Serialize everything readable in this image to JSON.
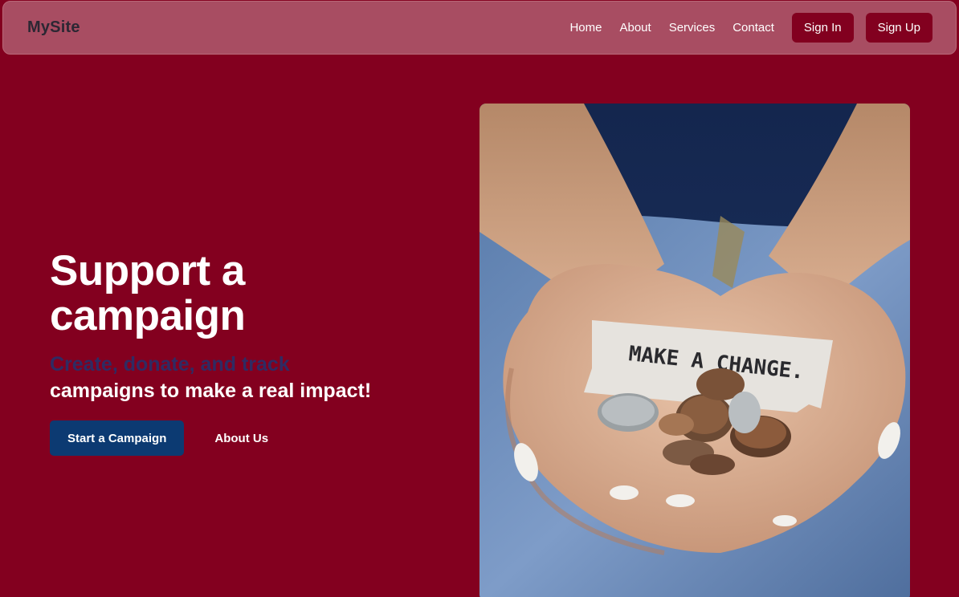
{
  "navbar": {
    "brand": "MySite",
    "links": [
      "Home",
      "About",
      "Services",
      "Contact"
    ],
    "sign_in": "Sign In",
    "sign_up": "Sign Up"
  },
  "hero": {
    "title_line1": "Support a",
    "title_line2": "campaign",
    "subtitle_line1": "Create, donate, and track",
    "subtitle_line2": "campaigns to make a real impact!",
    "primary_button": "Start a Campaign",
    "secondary_button": "About Us",
    "image_note_text": "MAKE A CHANGE."
  },
  "colors": {
    "background": "#83001f",
    "navbar": "#a84d62",
    "primary_button": "#0c3a72",
    "nav_button": "#82001f"
  }
}
